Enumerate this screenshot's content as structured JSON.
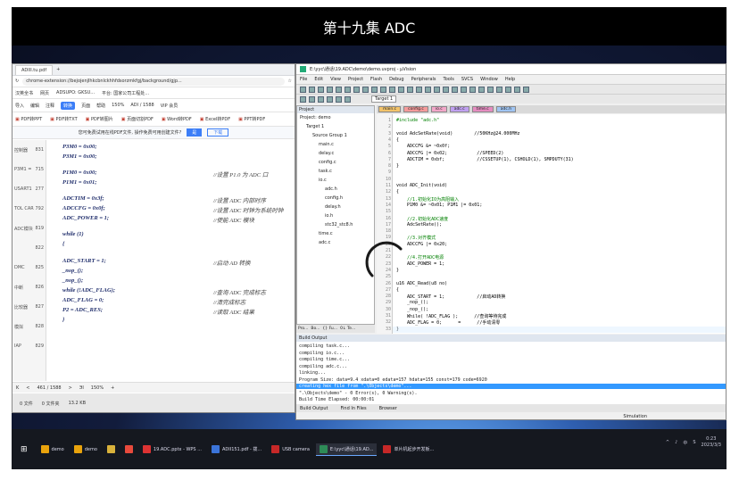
{
  "video_title": "第十九集 ADC",
  "pdf": {
    "tab_label": "ADIII.tu.pdf",
    "url": "chrome-extension://bejojenjlhkcbnlckhhfdsorzmkfgj/background/gjp...",
    "bookmarks": [
      "汉英全书",
      "网页",
      "ADSUPO: GKSU...",
      "平台: 国家公司工程处..."
    ],
    "menu": [
      "导入",
      "编辑",
      "注释",
      "转换",
      "页面",
      "帮助"
    ],
    "menu_active": "转换",
    "zoom": "150%",
    "page_nav": "ADI / 1588",
    "vip_label": "VIP 会员",
    "tools": [
      "PDF转PPT",
      "PDF转TXT",
      "PDF转图片",
      "页面切割PDF",
      "Word转PDF",
      "Excel转PDF",
      "PPT转PDF"
    ],
    "notice_text": "您可免费试用在线PDF文件, 操作免费可用创建文件?",
    "notice_btn_yes": "是",
    "notice_btn_no": "下载",
    "side_rows": [
      [
        "控制器",
        "831"
      ],
      [
        "P3M1 =",
        "715"
      ],
      [
        "USART1",
        "277"
      ],
      [
        "TOL CAR",
        "792"
      ],
      [
        "ADC模块",
        "819"
      ],
      [
        "",
        "822"
      ],
      [
        "DMC",
        "825"
      ],
      [
        "中断",
        "826"
      ],
      [
        "比较器",
        "827"
      ],
      [
        "模拟",
        "828"
      ],
      [
        "IAP",
        "829"
      ]
    ],
    "code_lines": [
      {
        "text": "P3M0 = 0x00;",
        "comment": ""
      },
      {
        "text": "P3M1 = 0x00;",
        "comment": ""
      },
      {
        "text": "P1M0 = 0x00;",
        "comment": "//设置 P1.0 为 ADC 口"
      },
      {
        "text": "P1M1 = 0x01;",
        "comment": ""
      },
      {
        "text": "ADCTIM = 0x3f;",
        "comment": "//设置 ADC 内部时序"
      },
      {
        "text": "ADCCFG = 0x0f;",
        "comment": "//设置 ADC 时钟为系统时钟"
      },
      {
        "text": "ADC_POWER = 1;",
        "comment": "//使能 ADC 模块"
      },
      {
        "text": "while (1)",
        "comment": ""
      },
      {
        "text": "{",
        "comment": ""
      },
      {
        "text": "    ADC_START = 1;",
        "comment": "//启动 AD 转换"
      },
      {
        "text": "    _nop_();",
        "comment": ""
      },
      {
        "text": "    _nop_();",
        "comment": ""
      },
      {
        "text": "    while (!ADC_FLAG);",
        "comment": "//查询 ADC 完成标志"
      },
      {
        "text": "    ADC_FLAG = 0;",
        "comment": "//清完成标志"
      },
      {
        "text": "    P2 = ADC_RES;",
        "comment": "//读取 ADC 结果"
      },
      {
        "text": "}",
        "comment": ""
      }
    ],
    "status": [
      "K",
      "<",
      "461 / 1588",
      ">",
      "ЭI",
      "150%",
      "+"
    ],
    "status_bottom": [
      "0 文件",
      "0 文件夹",
      "13.2 KB"
    ]
  },
  "uvision": {
    "title": "E:\\yyc\\通话\\19.ADC\\demo\\demo.uvproj - µVision",
    "menu": [
      "File",
      "Edit",
      "View",
      "Project",
      "Flash",
      "Debug",
      "Peripherals",
      "Tools",
      "SVCS",
      "Window",
      "Help"
    ],
    "target": "Target 1",
    "project_header": "Project",
    "tree": [
      {
        "label": "Project: demo",
        "indent": 0
      },
      {
        "label": "Target 1",
        "indent": 1
      },
      {
        "label": "Source Group 1",
        "indent": 2
      },
      {
        "label": "main.c",
        "indent": 3
      },
      {
        "label": "delay.c",
        "indent": 3
      },
      {
        "label": "config.c",
        "indent": 3
      },
      {
        "label": "task.c",
        "indent": 3
      },
      {
        "label": "io.c",
        "indent": 3
      },
      {
        "label": "adc.h",
        "indent": 4
      },
      {
        "label": "config.h",
        "indent": 4
      },
      {
        "label": "delay.h",
        "indent": 4
      },
      {
        "label": "io.h",
        "indent": 4
      },
      {
        "label": "stc32_stc8.h",
        "indent": 4
      },
      {
        "label": "time.c",
        "indent": 3
      },
      {
        "label": "adc.c",
        "indent": 3
      }
    ],
    "project_tabs": [
      "Pro...",
      "Bo...",
      "{} Fu...",
      "0↓ Te..."
    ],
    "editor_tabs": [
      "main.c",
      "config.c",
      "io.c",
      "adc.c",
      "time.c",
      "adc.h"
    ],
    "lines": [
      {
        "n": "1",
        "code": "#include \"adc.h\"",
        "type": "cm"
      },
      {
        "n": "2",
        "code": "",
        "type": ""
      },
      {
        "n": "3",
        "code": "void AdcSetRate(void)        //50KHz@24.000MHz",
        "type": ""
      },
      {
        "n": "4",
        "code": "{",
        "type": ""
      },
      {
        "n": "5",
        "code": "    ADCCFG &= ~0x0f;",
        "type": ""
      },
      {
        "n": "6",
        "code": "    ADCCFG |= 0x02;           //SPEED(2)",
        "type": ""
      },
      {
        "n": "7",
        "code": "    ADCTIM = 0xbf;            //CSSETUP(1), CSHOLD(1), SMPDUTY(31)",
        "type": ""
      },
      {
        "n": "8",
        "code": "}",
        "type": ""
      },
      {
        "n": "9",
        "code": "",
        "type": ""
      },
      {
        "n": "10",
        "code": "",
        "type": ""
      },
      {
        "n": "11",
        "code": "void ADC_Init(void)",
        "type": ""
      },
      {
        "n": "12",
        "code": "{",
        "type": ""
      },
      {
        "n": "13",
        "code": "    //1.初始化IO为高阻输入",
        "type": "cm"
      },
      {
        "n": "14",
        "code": "    P1M0 &= ~0x01; P1M1 |= 0x01;",
        "type": ""
      },
      {
        "n": "15",
        "code": "",
        "type": ""
      },
      {
        "n": "16",
        "code": "    //2.初始化ADC速度",
        "type": "cm"
      },
      {
        "n": "17",
        "code": "    AdcSetRate();",
        "type": ""
      },
      {
        "n": "18",
        "code": "",
        "type": ""
      },
      {
        "n": "19",
        "code": "    //3.对齐模式",
        "type": "cm"
      },
      {
        "n": "20",
        "code": "    ADCCFG |= 0x20;",
        "type": ""
      },
      {
        "n": "21",
        "code": "",
        "type": ""
      },
      {
        "n": "22",
        "code": "    //4.打开ADC电源",
        "type": "cm"
      },
      {
        "n": "23",
        "code": "    ADC_POWER = 1;",
        "type": ""
      },
      {
        "n": "24",
        "code": "}",
        "type": ""
      },
      {
        "n": "25",
        "code": "",
        "type": ""
      },
      {
        "n": "26",
        "code": "u16 ADC_Read(u8 no)",
        "type": ""
      },
      {
        "n": "27",
        "code": "{",
        "type": ""
      },
      {
        "n": "28",
        "code": "    ADC_START = 1;            //启动AD转换",
        "type": ""
      },
      {
        "n": "29",
        "code": "    _nop_();",
        "type": ""
      },
      {
        "n": "30",
        "code": "    _nop_();",
        "type": ""
      },
      {
        "n": "31",
        "code": "    While( !ADC_FLAG );      //查询等待完成",
        "type": ""
      },
      {
        "n": "32",
        "code": "    ADC_FLAG = 0;      =      //手动清零",
        "type": ""
      },
      {
        "n": "33",
        "code": "}",
        "type": ""
      }
    ],
    "build_header": "Build Output",
    "build_lines": [
      "compiling task.c...",
      "compiling io.c...",
      "compiling time.c...",
      "compiling adc.c...",
      "linking...",
      "Program Size: data=9.4 xdata=0 edata=157 hdata=155 const=179 code=6920",
      "creating hex file from \".\\Objects\\demo\"...",
      "\".\\Objects\\demo\" - 0 Error(s), 0 Warning(s).",
      "Build Time Elapsed:  00:00:01"
    ],
    "build_selected_index": 6,
    "build_tabs": [
      "Build Output",
      "Find In Files",
      "Browser"
    ],
    "status_right": "Simulation"
  },
  "taskbar": {
    "items": [
      {
        "label": "demo",
        "color": "#e9a30c"
      },
      {
        "label": "demo",
        "color": "#e9a30c"
      },
      {
        "label": "",
        "color": "#d9b23b"
      },
      {
        "label": "",
        "color": "#e84a3c"
      },
      {
        "label": "19.ADC.pptx - WPS ...",
        "color": "#d33"
      },
      {
        "label": "ADII151.pdf - 拨...",
        "color": "#3b74d9"
      },
      {
        "label": "USB camera",
        "color": "#c62828"
      },
      {
        "label": "E:\\yyc\\通话\\19.AD...",
        "color": "#2e8b57"
      },
      {
        "label": "单片机起步开发板...",
        "color": "#c62828"
      }
    ],
    "active_index": 7,
    "tray": [
      "^",
      "♪",
      "中",
      "S"
    ],
    "time": "0:23",
    "date": "2023/3/3"
  }
}
